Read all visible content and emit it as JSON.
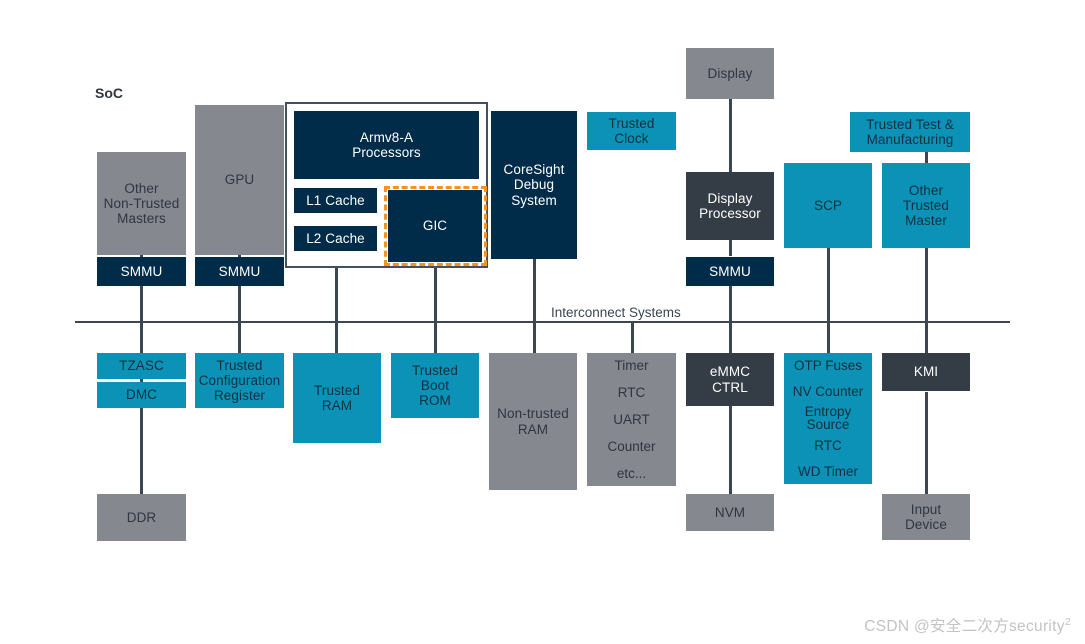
{
  "diagram": {
    "soc_label": "SoC",
    "bus_label": "Interconnect Systems",
    "watermark_prefix": "CSDN @安全二次方security",
    "watermark_sup": "2",
    "colors": {
      "gray": "#85888f",
      "teal": "#0c91b7",
      "navy": "#002b49",
      "charcoal": "#343c45",
      "line": "#3b4652",
      "highlight_dashed": "#f29323",
      "background": "#ffffff",
      "watermark": "#c3c3c3"
    }
  },
  "blocks": {
    "other_non_trusted_masters": "Other\nNon-Trusted\nMasters",
    "smmu_1": "SMMU",
    "gpu": "GPU",
    "smmu_2": "SMMU",
    "armv8a_processors": "Armv8-A\nProcessors",
    "l1_cache": "L1 Cache",
    "l2_cache": "L2 Cache",
    "gic": "GIC",
    "coresight_debug_system": "CoreSight\nDebug\nSystem",
    "trusted_clock": "Trusted\nClock",
    "display": "Display",
    "display_processor": "Display\nProcessor",
    "smmu_3": "SMMU",
    "scp": "SCP",
    "trusted_test_manufacturing": "Trusted Test &\nManufacturing",
    "other_trusted_master": "Other\nTrusted\nMaster",
    "tzasc": "TZASC",
    "dmc": "DMC",
    "ddr": "DDR",
    "trusted_configuration_register": "Trusted\nConfiguration\nRegister",
    "trusted_ram": "Trusted\nRAM",
    "trusted_boot_rom": "Trusted\nBoot\nROM",
    "non_trusted_ram": "Non-trusted\nRAM",
    "emmc_ctrl": "eMMC\nCTRL",
    "nvm": "NVM",
    "kmi": "KMI",
    "input_device": "Input\nDevice"
  },
  "peripheral_stack": {
    "items": [
      "Timer",
      "RTC",
      "UART",
      "Counter",
      "etc..."
    ]
  },
  "trusted_peripheral_stack": {
    "items": [
      "OTP Fuses",
      "NV Counter",
      "Entropy\nSource",
      "RTC",
      "WD Timer"
    ]
  }
}
